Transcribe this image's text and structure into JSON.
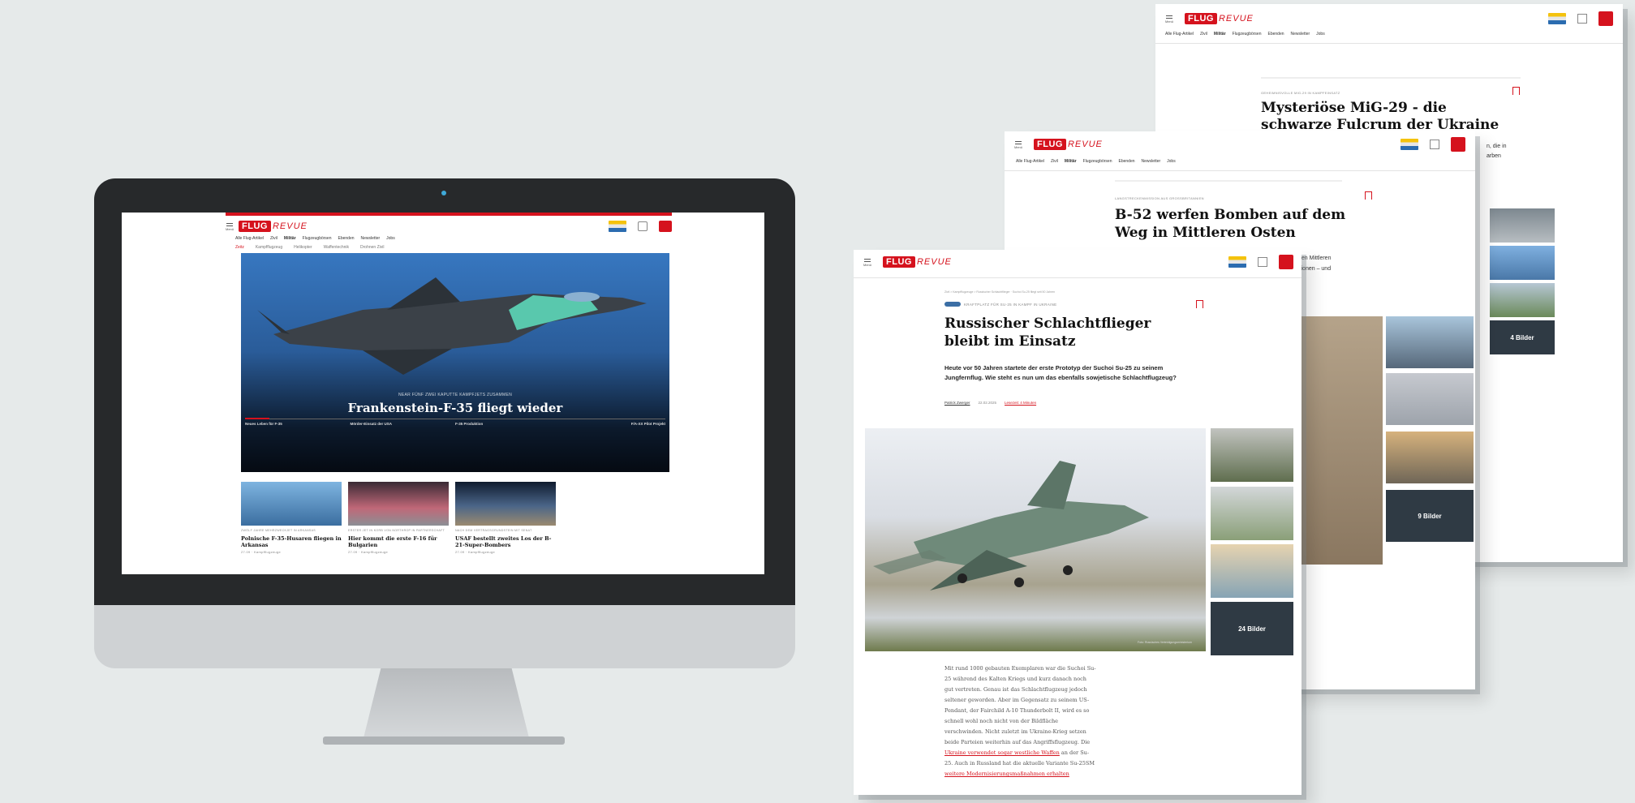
{
  "logo": {
    "mark": "FLUG",
    "suffix": "REVUE"
  },
  "menu_label": "Menü",
  "desktop": {
    "nav": [
      "Alle Flug-Artikel",
      "Zivil",
      "Militär",
      "Flugzeugbörsen",
      "Ebenden",
      "Newsletter",
      "Jobs"
    ],
    "subnav": [
      "Zeitz",
      "Kampfflugzeug",
      "Helikopter",
      "Waffentechnik",
      "Drohnen Zivil"
    ],
    "hero": {
      "kicker": "NEAR FÜNF ZWEI KAPUTTE KAMPFJETS ZUSAMMEN",
      "title": "Frankenstein-F-35 fliegt wieder",
      "tabs": [
        "Neues Leben für F-35",
        "Mörder-Einsatz der USA",
        "F-35 Produktion",
        "F/A-XX Pilot Projekt"
      ]
    },
    "cards": [
      {
        "kicker": "ZWÖLF JAHRE MEHRZWECKJET IN ARKANSAS",
        "title": "Polnische F-35-Husaren fliegen in Arkansas",
        "meta": "27.09 · Kampfflugzeuge"
      },
      {
        "kicker": "ERSTER JET IN KORB VON NORTHROP IN PARTNERSCHAFT",
        "title": "Hier kommt die erste F-16 für Bulgarien",
        "meta": "27.09 · Kampfflugzeuge"
      },
      {
        "kicker": "NACH DEM VERTRAGSGRUNDSTEIN MIT SENAT",
        "title": "USAF bestellt zweites Los der B-21-Super-Bombers",
        "meta": "27.09 · Kampfflugzeuge"
      }
    ]
  },
  "doc_back": {
    "nav": [
      "Alle Flug-Artikel",
      "Zivil",
      "Militär",
      "Flugzeugbörsen",
      "Ebenden",
      "Newsletter",
      "Jobs"
    ],
    "kicker": "GEHEIMNISVOLLE MIG-29 IN KAMPFEINSATZ",
    "title": "Mysteriöse MiG-29 - die schwarze Fulcrum der Ukraine",
    "count_label": "4 Bilder",
    "partial_text": [
      "",
      "n, die in",
      "arben"
    ]
  },
  "doc_mid": {
    "nav": [
      "Alle Flug-Artikel",
      "Zivil",
      "Militär",
      "Flugzeugbörsen",
      "Ebenden",
      "Newsletter",
      "Jobs"
    ],
    "kicker": "LANGSTRECKENMISSION AUS GROSSBRITANNIEN",
    "title": "B-52 werfen Bomben auf dem Weg in Mittleren Osten",
    "partial_text": [
      "den Mittleren",
      "itionen – und"
    ],
    "count_label": "9 Bilder"
  },
  "doc_front": {
    "breadcrumb": "Zivil > Kampfflugzeuge > Russischer Schlachtflieger · Suchoi Su-25 fliegt seit 50 Jahren",
    "kicker": "KRAFTPLATZ FÜR SU-25 IN KAMPF IN UKRAINE",
    "title": "Russischer Schlachtflieger bleibt im Einsatz",
    "lead": "Heute vor 50 Jahren startete der erste Prototyp der Suchoi Su-25 zu seinem Jungfernflug. Wie steht es nun um das ebenfalls sowjetische Schlachtflugzeug?",
    "author": "Patrick Zwerger",
    "date": "22.02.2025",
    "link": "Lesezeit: 4 Minuten",
    "count_label": "24 Bilder",
    "credit": "Foto: Russisches Verteidigungsministerium",
    "body": [
      "Mit rund 1000 gebauten Exemplaren war die Suchoi Su-",
      "25 während des Kalten Kriegs und kurz danach noch",
      "gut vertreten. Genau ist das Schlachtflugzeug jedoch",
      "seltener geworden. Aber im Gegensatz zu seinem US-",
      "Pendant, der Fairchild A-10 Thunderbolt II, wird es so",
      "schnell wohl noch nicht von der Bildfläche",
      "verschwinden. Nicht zuletzt im Ukraine-Krieg setzen",
      "beide Parteien weiterhin auf das Angriffsflugzeug. Die"
    ],
    "body_link1": "Ukraine verwendet sogar westliche Waffen",
    "body_tail1": " an der Su-",
    "body_line10": "25. Auch in Russland hat die aktuelle Variante Su-25SM",
    "body_link2": "weitere Modernisierungsmaßnahmen erhalten"
  },
  "colors": {
    "brand_red": "#d5121d",
    "background": "#e6eaea",
    "bezel": "#27292b"
  }
}
